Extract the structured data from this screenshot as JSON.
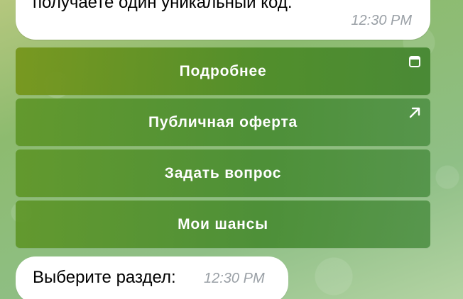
{
  "messages": {
    "top": {
      "text": "получаете один уникальный код.",
      "time": "12:30 PM"
    },
    "bottom": {
      "text": "Выберите раздел:",
      "time": "12:30 PM"
    }
  },
  "keyboard": {
    "buttons": [
      {
        "label": "Подробнее",
        "icon": "web-app-icon"
      },
      {
        "label": "Публичная оферта",
        "icon": "external-link-arrow-icon"
      },
      {
        "label": "Задать вопрос",
        "icon": ""
      },
      {
        "label": "Мои шансы",
        "icon": ""
      }
    ]
  },
  "colors": {
    "button_green": "#5a9a30",
    "bubble": "#ffffff",
    "time": "#9aa0a6"
  }
}
